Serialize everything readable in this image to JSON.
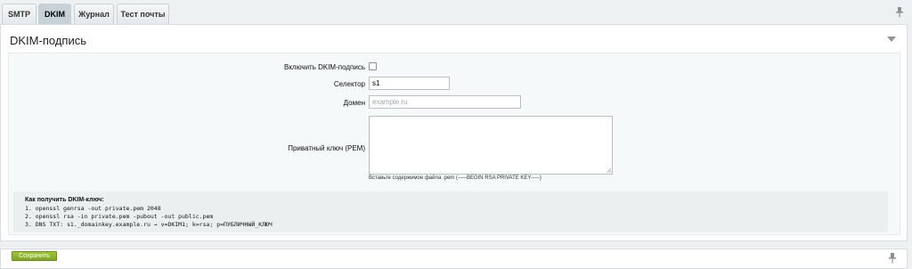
{
  "tabs": [
    {
      "label": "SMTP"
    },
    {
      "label": "DKIM"
    },
    {
      "label": "Журнал"
    },
    {
      "label": "Тест почты"
    }
  ],
  "panel": {
    "title": "DKIM-подпись"
  },
  "form": {
    "enable_label": "Включить DKIM-подпись",
    "enable_checked": false,
    "selector_label": "Селектор",
    "selector_value": "s1",
    "domain_label": "Домен",
    "domain_placeholder": "example.ru",
    "private_key_label": "Приватный ключ (PEM)",
    "private_key_value": "",
    "private_key_hint": "Вставьте содержимое файла .pem (-----BEGIN RSA PRIVATE KEY-----)"
  },
  "help": {
    "title": "Как получить DKIM-ключ:",
    "lines": [
      "1. openssl genrsa -out private.pem 2048",
      "2. openssl rsa -in private.pem -pubout -out public.pem",
      "3. DNS TXT: s1._domainkey.example.ru → v=DKIM1; k=rsa; p=ПУБЛИЧНЫЙ_КЛЮЧ"
    ]
  },
  "footer": {
    "save_label": "Сохранить"
  },
  "colors": {
    "active_tab": "#c7d2d8",
    "save_button": "#8db42e"
  },
  "icons": {
    "pin": "pin-icon",
    "collapse": "collapse-arrow-icon"
  }
}
